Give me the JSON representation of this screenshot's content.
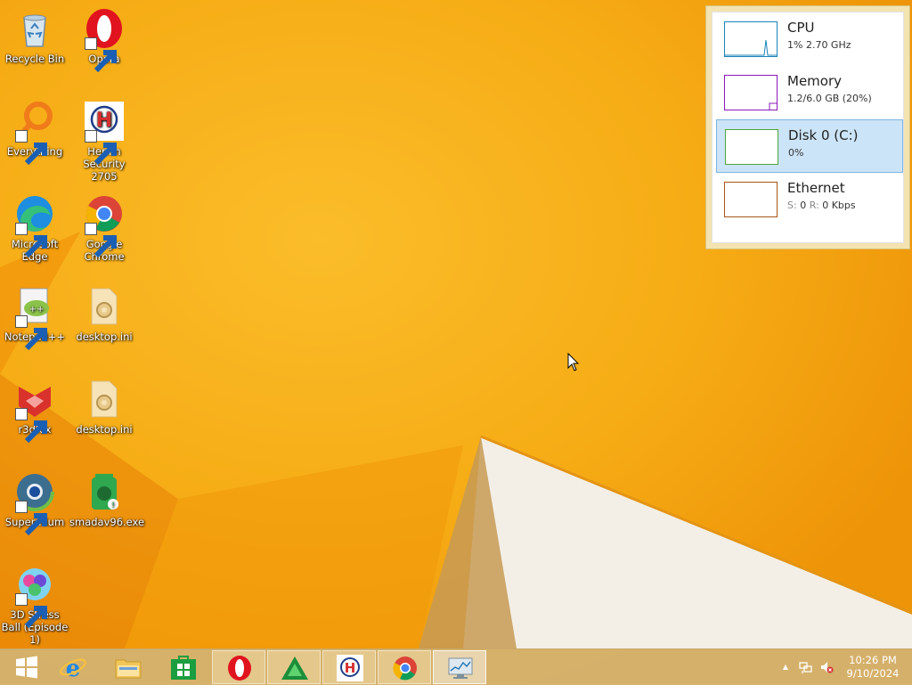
{
  "desktop": {
    "icons": [
      {
        "label": "Recycle Bin",
        "icon": "recycle-bin-icon"
      },
      {
        "label": "Opera",
        "icon": "opera-icon"
      },
      {
        "label": "Everything",
        "icon": "everything-search-icon"
      },
      {
        "label": "Hemin Security 2705",
        "icon": "hemin-security-icon"
      },
      {
        "label": "Microsoft Edge",
        "icon": "edge-icon"
      },
      {
        "label": "Google Chrome",
        "icon": "chrome-icon"
      },
      {
        "label": "Notepad++",
        "icon": "notepadpp-icon"
      },
      {
        "label": "desktop.ini",
        "icon": "ini-file-icon"
      },
      {
        "label": "r3dfox",
        "icon": "r3dfox-icon"
      },
      {
        "label": "desktop.ini",
        "icon": "ini-file-icon"
      },
      {
        "label": "Supermium",
        "icon": "supermium-icon"
      },
      {
        "label": "smadav96.exe",
        "icon": "smadav-icon"
      },
      {
        "label": "3D Stress Ball (Episode 1)",
        "icon": "stress-ball-icon"
      }
    ]
  },
  "performance": {
    "items": [
      {
        "title": "CPU",
        "value": "1%  2.70 GHz",
        "color": "#1b84b8",
        "selected": false
      },
      {
        "title": "Memory",
        "value": "1.2/6.0 GB (20%)",
        "color": "#8b18b8",
        "selected": false
      },
      {
        "title": "Disk 0 (C:)",
        "value": "0%",
        "color": "#4da63a",
        "selected": true
      },
      {
        "title": "Ethernet",
        "value_s_label": "S:",
        "value_s": "0",
        "value_r_label": "R:",
        "value_r": "0 Kbps",
        "color": "#a7551a",
        "selected": false
      }
    ]
  },
  "taskbar": {
    "buttons": [
      {
        "name": "start",
        "icon": "windows-start-icon"
      },
      {
        "name": "internet-explorer",
        "icon": "internet-explorer-icon"
      },
      {
        "name": "file-explorer",
        "icon": "file-explorer-icon"
      },
      {
        "name": "store",
        "icon": "store-icon"
      },
      {
        "name": "opera",
        "icon": "opera-icon"
      },
      {
        "name": "smadav",
        "icon": "smadav-taskbar-icon"
      },
      {
        "name": "hemin-security",
        "icon": "hemin-security-icon"
      },
      {
        "name": "chrome",
        "icon": "chrome-icon"
      },
      {
        "name": "task-manager",
        "icon": "task-manager-icon"
      }
    ],
    "tray": {
      "show_hidden": "▲",
      "time": "10:26 PM",
      "date": "9/10/2024"
    }
  },
  "colors": {
    "wallpaper": "#f4a60e",
    "accent_selected": "#cce4f7"
  }
}
